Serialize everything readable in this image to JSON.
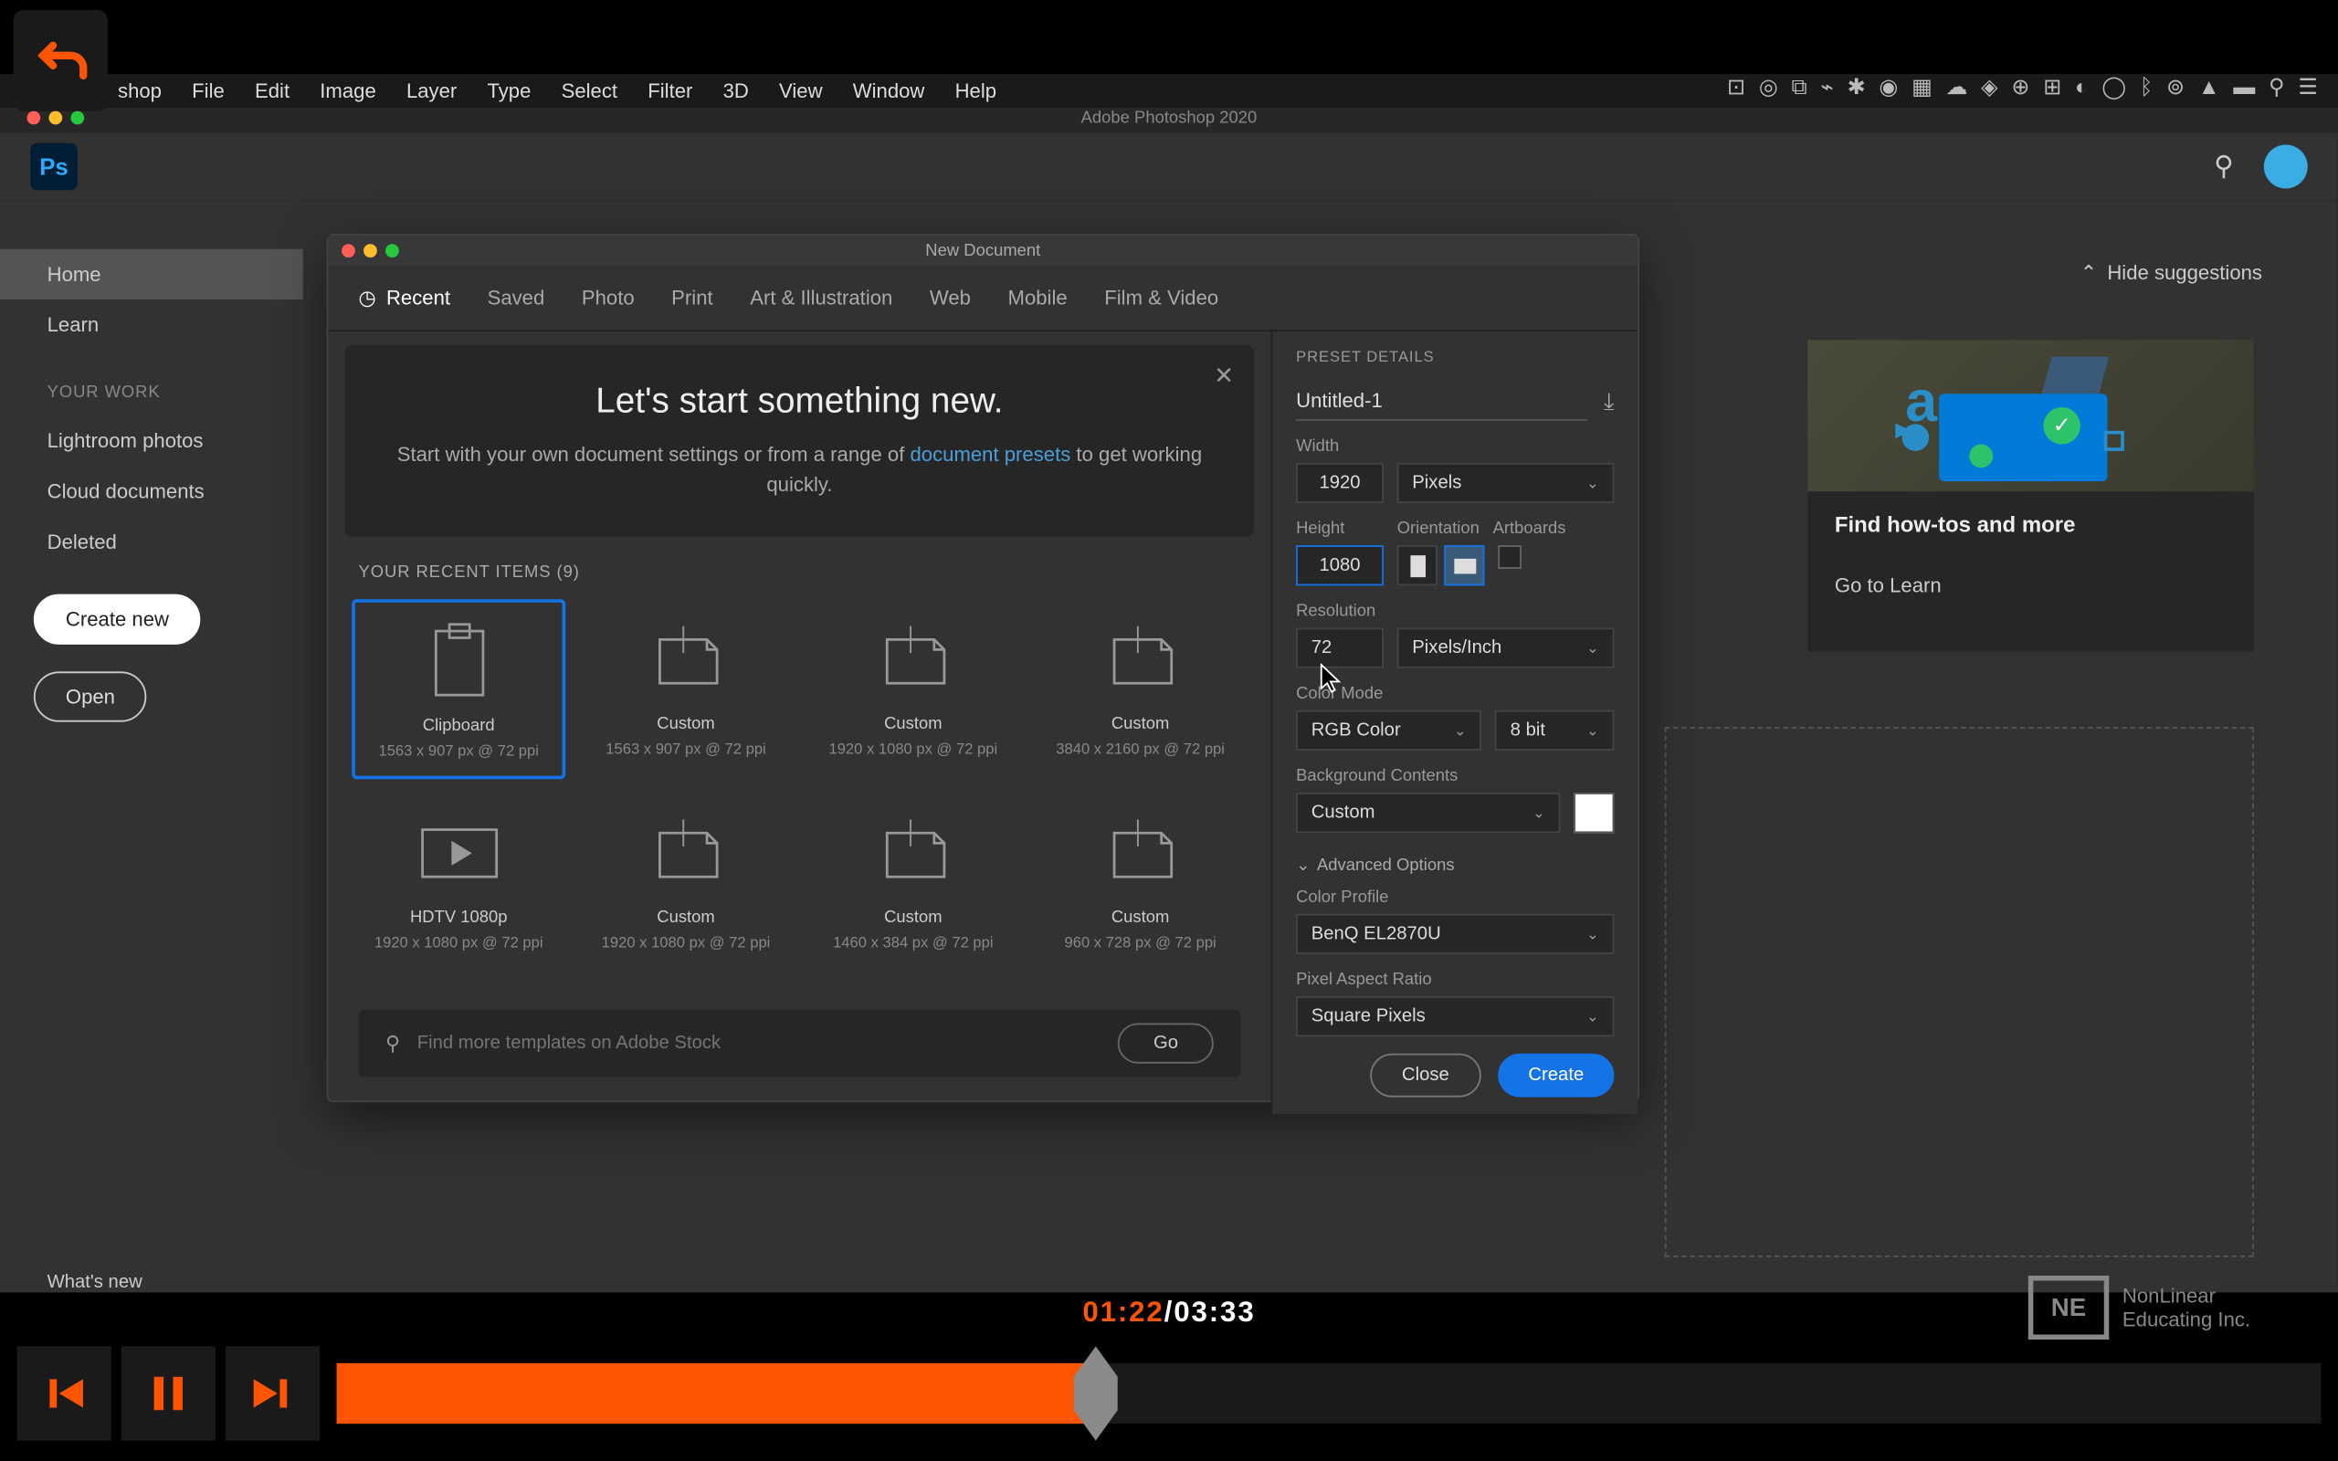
{
  "menubar": [
    "shop",
    "File",
    "Edit",
    "Image",
    "Layer",
    "Type",
    "Select",
    "Filter",
    "3D",
    "View",
    "Window",
    "Help"
  ],
  "title": "Adobe Photoshop 2020",
  "sidebar": {
    "home": "Home",
    "learn": "Learn",
    "your_work": "YOUR WORK",
    "items": [
      "Lightroom photos",
      "Cloud documents",
      "Deleted"
    ],
    "create": "Create new",
    "open": "Open"
  },
  "whatsnew": "What's new",
  "hide_suggestions": "Hide suggestions",
  "learn_card": {
    "title": "Find how-tos and more",
    "link": "Go to Learn"
  },
  "dialog": {
    "title": "New Document",
    "tabs": [
      "Recent",
      "Saved",
      "Photo",
      "Print",
      "Art & Illustration",
      "Web",
      "Mobile",
      "Film & Video"
    ],
    "banner_title": "Let's start something new.",
    "banner_text_a": "Start with your own document settings or from a range of ",
    "banner_link": "document presets",
    "banner_text_b": " to get working quickly.",
    "recent_label": "YOUR RECENT ITEMS  (9)",
    "presets": [
      {
        "name": "Clipboard",
        "dims": "1563 x 907 px @ 72 ppi"
      },
      {
        "name": "Custom",
        "dims": "1563 x 907 px @ 72 ppi"
      },
      {
        "name": "Custom",
        "dims": "1920 x 1080 px @ 72 ppi"
      },
      {
        "name": "Custom",
        "dims": "3840 x 2160 px @ 72 ppi"
      },
      {
        "name": "HDTV 1080p",
        "dims": "1920 x 1080 px @ 72 ppi"
      },
      {
        "name": "Custom",
        "dims": "1920 x 1080 px @ 72 ppi"
      },
      {
        "name": "Custom",
        "dims": "1460 x 384 px @ 72 ppi"
      },
      {
        "name": "Custom",
        "dims": "960 x 728 px @ 72 ppi"
      }
    ],
    "stock_placeholder": "Find more templates on Adobe Stock",
    "go": "Go",
    "preset_details": "PRESET DETAILS",
    "untitled": "Untitled-1",
    "width_lbl": "Width",
    "width": "1920",
    "width_unit": "Pixels",
    "height_lbl": "Height",
    "orientation_lbl": "Orientation",
    "artboards_lbl": "Artboards",
    "height": "1080",
    "res_lbl": "Resolution",
    "resolution": "72",
    "res_unit": "Pixels/Inch",
    "color_lbl": "Color Mode",
    "color_mode": "RGB Color",
    "bit_depth": "8 bit",
    "bg_lbl": "Background Contents",
    "bg": "Custom",
    "advanced": "Advanced Options",
    "profile_lbl": "Color Profile",
    "profile": "BenQ EL2870U",
    "aspect_lbl": "Pixel Aspect Ratio",
    "aspect": "Square Pixels",
    "close": "Close",
    "create": "Create"
  },
  "player": {
    "current": "01:22",
    "total": "03:33"
  },
  "logo": {
    "short": "NE",
    "line1": "NonLinear",
    "line2": "Educating Inc."
  }
}
